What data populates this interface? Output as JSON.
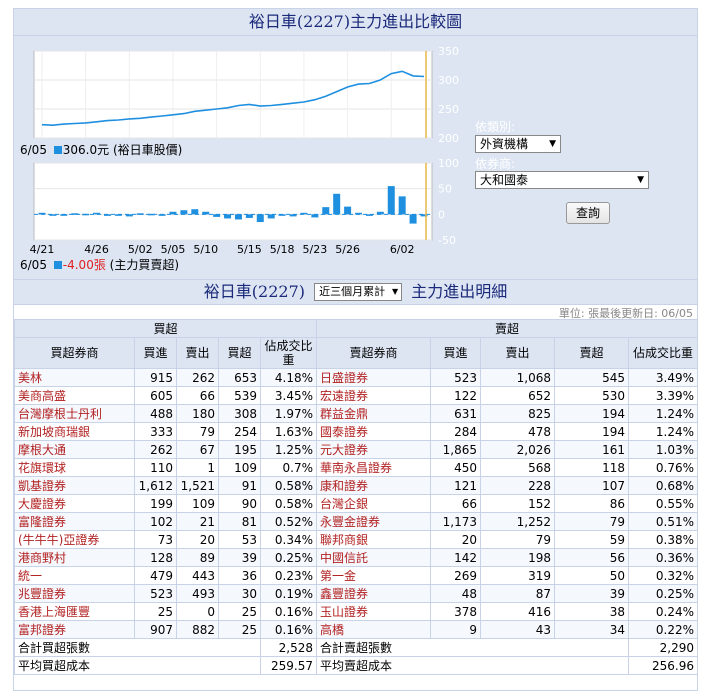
{
  "top_title": "裕日車(2227)主力進出比較圖",
  "price_chart": {
    "right_ticks": [
      "350",
      "300",
      "250",
      "200"
    ],
    "date": "6/05",
    "legend_value": "306.0元",
    "legend_label": "(裕日車股價)",
    "colors": {
      "line": "#1f8fe0",
      "cursor": "#e8b84a"
    },
    "chart_data": {
      "type": "line",
      "x": [
        "4/21",
        "4/22",
        "4/23",
        "4/24",
        "4/25",
        "4/26",
        "4/27",
        "4/28",
        "4/29",
        "5/02",
        "5/03",
        "5/04",
        "5/05",
        "5/06",
        "5/09",
        "5/10",
        "5/11",
        "5/12",
        "5/13",
        "5/15",
        "5/16",
        "5/17",
        "5/18",
        "5/19",
        "5/20",
        "5/23",
        "5/24",
        "5/25",
        "5/26",
        "5/27",
        "5/30",
        "5/31",
        "6/01",
        "6/02",
        "6/03",
        "6/05"
      ],
      "values": [
        223,
        222,
        224,
        225,
        226,
        228,
        230,
        231,
        233,
        234,
        236,
        238,
        240,
        242,
        246,
        248,
        250,
        252,
        256,
        258,
        255,
        256,
        258,
        260,
        262,
        266,
        272,
        280,
        288,
        293,
        294,
        300,
        311,
        315,
        307,
        306
      ],
      "ylim": [
        200,
        350
      ]
    }
  },
  "flow_chart": {
    "right_ticks": [
      "100",
      "50",
      "0",
      "-50"
    ],
    "x_ticks": [
      "4/21",
      "4/26",
      "5/02",
      "5/05",
      "5/10",
      "5/15",
      "5/18",
      "5/23",
      "5/26",
      "6/02"
    ],
    "date": "6/05",
    "legend_value": "-4.00張",
    "legend_label": "(主力買賣超)",
    "colors": {
      "bar": "#1f8fe0",
      "cursor": "#e8b84a",
      "neg_text": "#e02020"
    },
    "chart_data": {
      "type": "bar",
      "x": [
        "4/21",
        "4/22",
        "4/23",
        "4/24",
        "4/25",
        "4/26",
        "4/27",
        "4/28",
        "4/29",
        "5/02",
        "5/03",
        "5/04",
        "5/05",
        "5/06",
        "5/09",
        "5/10",
        "5/11",
        "5/12",
        "5/13",
        "5/15",
        "5/16",
        "5/17",
        "5/18",
        "5/19",
        "5/20",
        "5/23",
        "5/24",
        "5/25",
        "5/26",
        "5/27",
        "5/30",
        "5/31",
        "6/01",
        "6/02",
        "6/03",
        "6/05"
      ],
      "values": [
        3,
        -2,
        -1,
        2,
        1,
        3,
        -3,
        -1,
        -4,
        2,
        1,
        -2,
        5,
        8,
        10,
        5,
        -5,
        -8,
        -10,
        -7,
        -15,
        -8,
        -2,
        -4,
        3,
        -6,
        14,
        40,
        15,
        3,
        -3,
        5,
        55,
        35,
        -18,
        -4
      ],
      "ylim": [
        -50,
        100
      ]
    }
  },
  "filters": {
    "type_label": "依類別:",
    "type_value": "外資機構",
    "broker_label": "依券商:",
    "broker_value": "大和國泰",
    "query_button": "查詢"
  },
  "detail_title_prefix": "裕日車(2227)",
  "period_value": "近三個月累計",
  "detail_title_suffix": "主力進出明細",
  "unit_note": "單位: 張最後更新日: 06/05",
  "table": {
    "buy_group": "買超",
    "sell_group": "賣超",
    "headers_buy": [
      "買超券商",
      "買進",
      "賣出",
      "買超",
      "佔成交比重"
    ],
    "headers_sell": [
      "賣超券商",
      "買進",
      "賣出",
      "賣超",
      "佔成交比重"
    ],
    "rows": [
      {
        "b": [
          "美林",
          "915",
          "262",
          "653",
          "4.18%"
        ],
        "s": [
          "日盛證券",
          "523",
          "1,068",
          "545",
          "3.49%"
        ]
      },
      {
        "b": [
          "美商高盛",
          "605",
          "66",
          "539",
          "3.45%"
        ],
        "s": [
          "宏遠證券",
          "122",
          "652",
          "530",
          "3.39%"
        ]
      },
      {
        "b": [
          "台灣摩根士丹利",
          "488",
          "180",
          "308",
          "1.97%"
        ],
        "s": [
          "群益金鼎",
          "631",
          "825",
          "194",
          "1.24%"
        ]
      },
      {
        "b": [
          "新加坡商瑞銀",
          "333",
          "79",
          "254",
          "1.63%"
        ],
        "s": [
          "國泰證券",
          "284",
          "478",
          "194",
          "1.24%"
        ]
      },
      {
        "b": [
          "摩根大通",
          "262",
          "67",
          "195",
          "1.25%"
        ],
        "s": [
          "元大證券",
          "1,865",
          "2,026",
          "161",
          "1.03%"
        ]
      },
      {
        "b": [
          "花旗環球",
          "110",
          "1",
          "109",
          "0.7%"
        ],
        "s": [
          "華南永昌證券",
          "450",
          "568",
          "118",
          "0.76%"
        ]
      },
      {
        "b": [
          "凱基證券",
          "1,612",
          "1,521",
          "91",
          "0.58%"
        ],
        "s": [
          "康和證券",
          "121",
          "228",
          "107",
          "0.68%"
        ]
      },
      {
        "b": [
          "大慶證券",
          "199",
          "109",
          "90",
          "0.58%"
        ],
        "s": [
          "台灣企銀",
          "66",
          "152",
          "86",
          "0.55%"
        ]
      },
      {
        "b": [
          "富隆證券",
          "102",
          "21",
          "81",
          "0.52%"
        ],
        "s": [
          "永豐金證券",
          "1,173",
          "1,252",
          "79",
          "0.51%"
        ]
      },
      {
        "b": [
          "(牛牛牛)亞證券",
          "73",
          "20",
          "53",
          "0.34%"
        ],
        "s": [
          "聯邦商銀",
          "20",
          "79",
          "59",
          "0.38%"
        ]
      },
      {
        "b": [
          "港商野村",
          "128",
          "89",
          "39",
          "0.25%"
        ],
        "s": [
          "中國信託",
          "142",
          "198",
          "56",
          "0.36%"
        ]
      },
      {
        "b": [
          "統一",
          "479",
          "443",
          "36",
          "0.23%"
        ],
        "s": [
          "第一金",
          "269",
          "319",
          "50",
          "0.32%"
        ]
      },
      {
        "b": [
          "兆豐證券",
          "523",
          "493",
          "30",
          "0.19%"
        ],
        "s": [
          "鑫豐證券",
          "48",
          "87",
          "39",
          "0.25%"
        ]
      },
      {
        "b": [
          "香港上海匯豐",
          "25",
          "0",
          "25",
          "0.16%"
        ],
        "s": [
          "玉山證券",
          "378",
          "416",
          "38",
          "0.24%"
        ]
      },
      {
        "b": [
          "富邦證券",
          "907",
          "882",
          "25",
          "0.16%"
        ],
        "s": [
          "高橋",
          "9",
          "43",
          "34",
          "0.22%"
        ]
      }
    ],
    "total_buy_label": "合計買超張數",
    "total_buy_value": "2,528",
    "total_sell_label": "合計賣超張數",
    "total_sell_value": "2,290",
    "avg_buy_label": "平均買超成本",
    "avg_buy_value": "259.57",
    "avg_sell_label": "平均賣超成本",
    "avg_sell_value": "256.96"
  }
}
